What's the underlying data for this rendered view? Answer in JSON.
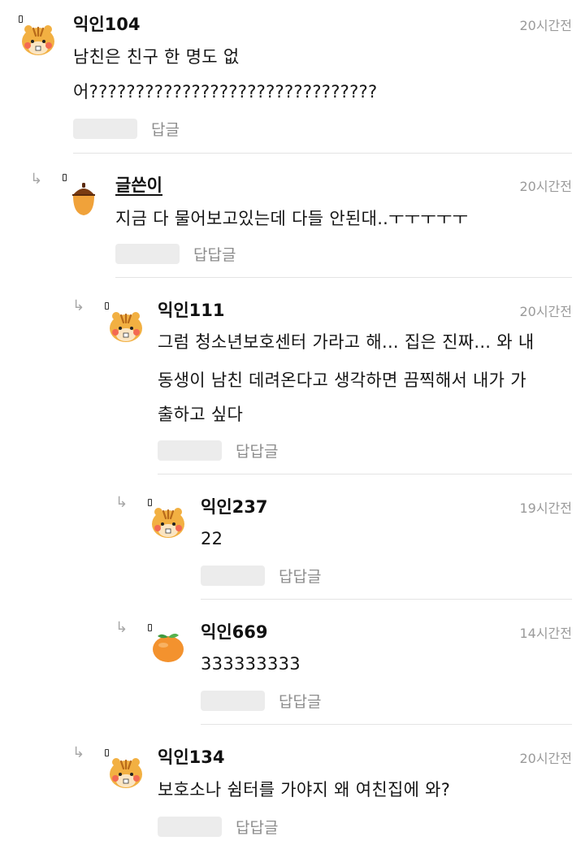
{
  "comments": [
    {
      "nick": "익인104",
      "time": "20시간전",
      "lines": [
        "남친은 친구 한 명도 없",
        "어???????????????????????????????"
      ],
      "reply_label": "답글",
      "avatar": "chipmunk-avatar"
    },
    {
      "nick": "글쓴이",
      "time": "20시간전",
      "lines": [
        "지금 다 물어보고있는데 다들 안된대..ㅜㅜㅜㅜㅜ"
      ],
      "reply_label": "답답글",
      "avatar": "acorn-avatar"
    },
    {
      "nick": "익인111",
      "time": "20시간전",
      "lines": [
        "그럼 청소년보호센터 가라고 해... 집은 진짜... 와 내",
        "동생이 남친 데려온다고 생각하면 끔찍해서 내가 가",
        "출하고 싶다"
      ],
      "reply_label": "답답글",
      "avatar": "chipmunk-avatar"
    },
    {
      "nick": "익인237",
      "time": "19시간전",
      "lines": [
        "22"
      ],
      "reply_label": "답답글",
      "avatar": "chipmunk-avatar"
    },
    {
      "nick": "익인669",
      "time": "14시간전",
      "lines": [
        "333333333"
      ],
      "reply_label": "답답글",
      "avatar": "tangerine-avatar"
    },
    {
      "nick": "익인134",
      "time": "20시간전",
      "lines": [
        "보호소나 쉼터를 가야지 왜 여친집에 와?"
      ],
      "reply_label": "답답글",
      "avatar": "chipmunk-avatar"
    }
  ],
  "icons": {
    "reply_arrow": "↳"
  }
}
